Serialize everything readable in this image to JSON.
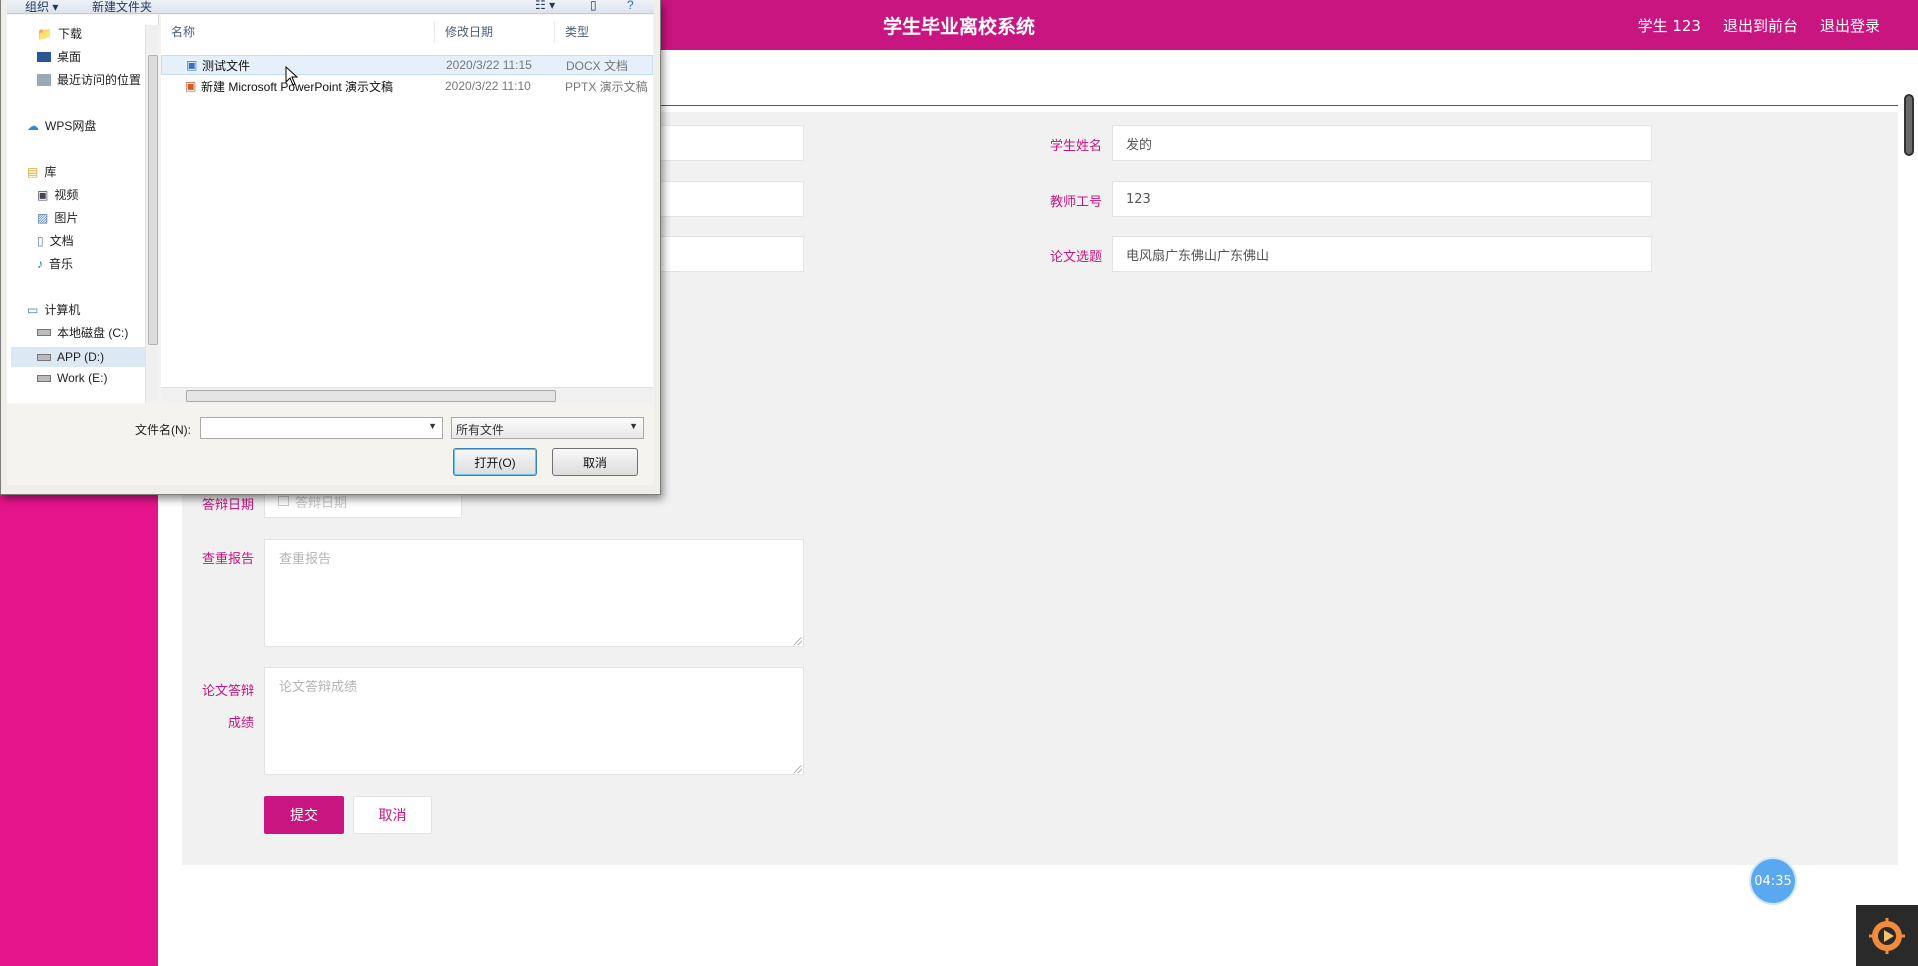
{
  "app": {
    "title": "学生毕业离校系统",
    "user_label": "学生 123",
    "back_to_front": "退出到前台",
    "logout": "退出登录",
    "brand_color": "#c8157f"
  },
  "form": {
    "student_name_label": "学生姓名",
    "student_name_value": "发的",
    "teacher_id_label": "教师工号",
    "teacher_id_value": "123",
    "thesis_topic_label": "论文选题",
    "thesis_topic_value": "电风扇广东佛山广东佛山",
    "defense_date_label": "答辩日期",
    "defense_date_placeholder": "答辩日期",
    "plagiarism_label": "查重报告",
    "plagiarism_placeholder": "查重报告",
    "defense_score_label_1": "论文答辩",
    "defense_score_label_2": "成绩",
    "defense_score_placeholder": "论文答辩成绩",
    "submit_label": "提交",
    "cancel_label": "取消"
  },
  "timer": "04:35",
  "dialog": {
    "toolbar": {
      "organize": "组织 ▾",
      "new_folder": "新建文件夹"
    },
    "nav_items": [
      {
        "label": "下载",
        "icon": "download-folder-icon"
      },
      {
        "label": "桌面",
        "icon": "desktop-icon"
      },
      {
        "label": "最近访问的位置",
        "icon": "recent-places-icon"
      },
      {
        "label": "WPS网盘",
        "icon": "cloud-icon"
      },
      {
        "label": "库",
        "icon": "library-icon"
      },
      {
        "label": "视频",
        "icon": "video-icon"
      },
      {
        "label": "图片",
        "icon": "picture-icon"
      },
      {
        "label": "文档",
        "icon": "document-icon"
      },
      {
        "label": "音乐",
        "icon": "music-icon"
      },
      {
        "label": "计算机",
        "icon": "computer-icon"
      },
      {
        "label": "本地磁盘 (C:)",
        "icon": "drive-icon"
      },
      {
        "label": "APP (D:)",
        "icon": "drive-icon"
      },
      {
        "label": "Work (E:)",
        "icon": "drive-icon"
      }
    ],
    "columns": {
      "name": "名称",
      "modified": "修改日期",
      "type": "类型"
    },
    "files": [
      {
        "name": "测试文件",
        "modified": "2020/3/22 11:15",
        "type": "DOCX 文档"
      },
      {
        "name": "新建 Microsoft PowerPoint 演示文稿",
        "modified": "2020/3/22 11:10",
        "type": "PPTX 演示文稿"
      }
    ],
    "filename_label": "文件名(N):",
    "filename_value": "",
    "filetype_value": "所有文件",
    "open_label": "打开(O)",
    "cancel_label": "取消"
  }
}
